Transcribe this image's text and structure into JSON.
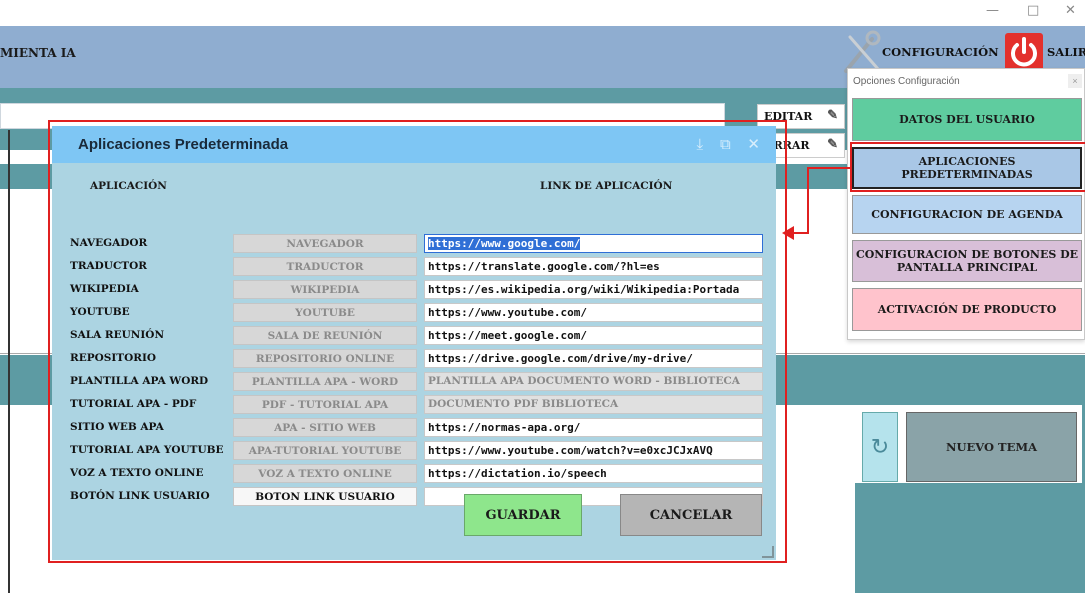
{
  "window": {
    "minimize": "—",
    "maximize": "□",
    "close": "✕"
  },
  "header": {
    "app_title": "MIENTA IA",
    "config_label": "CONFIGURACIÓN",
    "salir_label": "SALIR",
    "wrench_icon": "wrench-screwdriver-icon",
    "power_icon": "power-icon",
    "power_color": "#e3312d"
  },
  "background": {
    "edit_label": "EDITAR",
    "borrar_label": "ORRAR",
    "refresh_icon": "↻",
    "nuevo_tema_label": "NUEVO TEMA"
  },
  "config_panel": {
    "title": "Opciones Configuración",
    "close": "×",
    "items": [
      {
        "label": "DATOS DEL USUARIO",
        "color": "#5fcc9f"
      },
      {
        "label": "APLICACIONES PREDETERMINADAS",
        "color": "#a9c7e6"
      },
      {
        "label": "CONFIGURACION DE AGENDA",
        "color": "#b7d4f0"
      },
      {
        "label": "CONFIGURACION DE BOTONES DE PANTALLA PRINCIPAL",
        "color": "#d8bfd8"
      },
      {
        "label": "ACTIVACIÓN DE PRODUCTO",
        "color": "#ffc3cc"
      }
    ]
  },
  "dialog": {
    "title": "Aplicaciones Predeterminada",
    "icons": "⤓ ⧉ ✕",
    "header_color": "#7ec6f4",
    "col_app": "APLICACIÓN",
    "col_link": "LINK DE APLICACIÓN",
    "rows": [
      {
        "label": "NAVEGADOR",
        "name": "NAVEGADOR",
        "link": "https://www.google.com/"
      },
      {
        "label": "TRADUCTOR",
        "name": "TRADUCTOR",
        "link": "https://translate.google.com/?hl=es"
      },
      {
        "label": "WIKIPEDIA",
        "name": "WIKIPEDIA",
        "link": "https://es.wikipedia.org/wiki/Wikipedia:Portada"
      },
      {
        "label": "YOUTUBE",
        "name": "YOUTUBE",
        "link": "https://www.youtube.com/"
      },
      {
        "label": "SALA REUNIÓN",
        "name": "SALA DE REUNIÓN",
        "link": "https://meet.google.com/"
      },
      {
        "label": "REPOSITORIO",
        "name": "REPOSITORIO ONLINE",
        "link": "https://drive.google.com/drive/my-drive/"
      },
      {
        "label": "PLANTILLA APA WORD",
        "name": "PLANTILLA APA - WORD",
        "link": "PLANTILLA APA DOCUMENTO WORD - BIBLIOTECA"
      },
      {
        "label": "TUTORIAL APA - PDF",
        "name": "PDF - TUTORIAL APA",
        "link": "DOCUMENTO PDF BIBLIOTECA"
      },
      {
        "label": "SITIO WEB APA",
        "name": "APA - SITIO WEB",
        "link": "https://normas-apa.org/"
      },
      {
        "label": "TUTORIAL APA YOUTUBE",
        "name": "APA-TUTORIAL YOUTUBE",
        "link": "https://www.youtube.com/watch?v=e0xcJCJxAVQ"
      },
      {
        "label": "VOZ A TEXTO ONLINE",
        "name": "VOZ A TEXTO ONLINE",
        "link": "https://dictation.io/speech"
      },
      {
        "label": "BOTÓN LINK USUARIO",
        "name": "BOTON LINK USUARIO",
        "link": ""
      }
    ],
    "save_label": "GUARDAR",
    "cancel_label": "CANCELAR",
    "save_color": "#8ee68c",
    "cancel_color": "#b5b5b5"
  }
}
